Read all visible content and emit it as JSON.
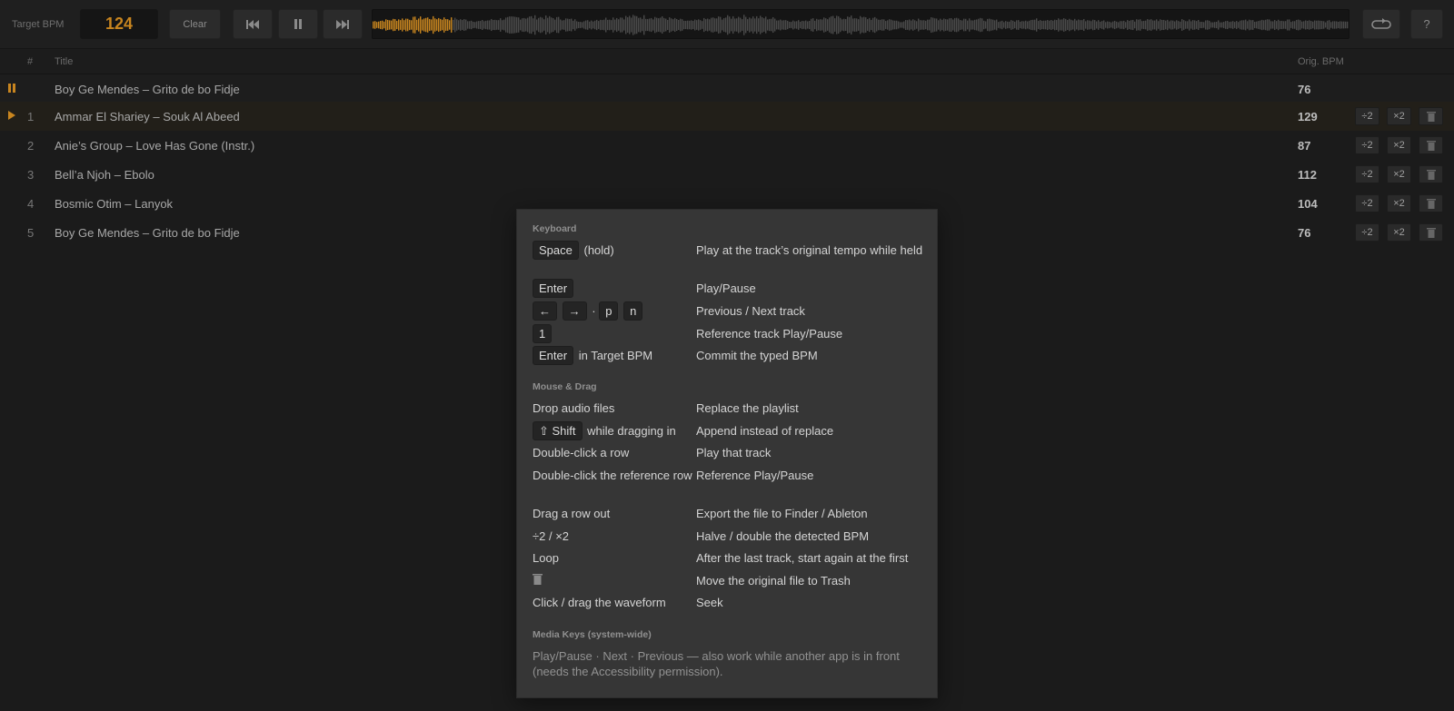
{
  "toolbar": {
    "target_bpm_label": "Target BPM",
    "target_bpm_value": "124",
    "clear_label": "Clear",
    "prev_icon": "skip-back-icon",
    "pause_icon": "pause-icon",
    "next_icon": "skip-forward-icon",
    "loop_icon": "loop-icon",
    "help_label": "?",
    "playback_progress": 0.08,
    "accent_color": "#c8851f"
  },
  "list": {
    "headers": {
      "num": "#",
      "title": "Title",
      "bpm": "Orig. BPM"
    },
    "reference": {
      "title": "Boy Ge Mendes – Grito de bo Fidje",
      "bpm": "76"
    },
    "tracks": [
      {
        "num": "1",
        "title": "Ammar El Shariey – Souk Al Abeed",
        "bpm": "129"
      },
      {
        "num": "2",
        "title": "Anie’s Group – Love Has Gone (Instr.)",
        "bpm": "87"
      },
      {
        "num": "3",
        "title": "Bell’a Njoh – Ebolo",
        "bpm": "112"
      },
      {
        "num": "4",
        "title": "Bosmic Otim – Lanyok",
        "bpm": "104"
      },
      {
        "num": "5",
        "title": "Boy Ge Mendes – Grito de bo Fidje",
        "bpm": "76"
      }
    ],
    "halve_label": "÷2",
    "double_label": "×2",
    "trash_icon": "trash-icon",
    "playing_icon": "play-triangle-icon",
    "reference_icon": "pause-bars-icon"
  },
  "help": {
    "keyboard_title": "Keyboard",
    "space_key": "Space",
    "space_suffix": "(hold)",
    "space_desc": "Play at the track’s original tempo while held",
    "enter_key": "Enter",
    "enter_desc": "Play/Pause",
    "left_key": "←",
    "right_key": "→",
    "sep_dot": "·",
    "p_key": "p",
    "n_key": "n",
    "nav_desc": "Previous / Next track",
    "one_key": "1",
    "one_desc": "Reference track Play/Pause",
    "enter2_key": "Enter",
    "enter2_suffix": "in Target BPM",
    "enter2_desc": "Commit the typed BPM",
    "mouse_title": "Mouse & Drag",
    "drop_key": "Drop audio files",
    "drop_desc": "Replace the playlist",
    "shift_key": "⇧ Shift",
    "shift_suffix": "while dragging in",
    "shift_desc": "Append instead of replace",
    "dbl_row_key": "Double-click a row",
    "dbl_row_desc": "Play that track",
    "dbl_ref_key": "Double-click the reference row",
    "dbl_ref_desc": "Reference Play/Pause",
    "drag_out_key": "Drag a row out",
    "drag_out_desc": "Export the file to Finder / Ableton",
    "halve_key": "÷2 / ×2",
    "halve_desc": "Halve / double the detected BPM",
    "loop_key": "Loop",
    "loop_desc": "After the last track, start again at the first",
    "trash_desc": "Move the original file to Trash",
    "waveform_key": "Click / drag the waveform",
    "waveform_desc": "Seek",
    "media_title": "Media Keys (system-wide)",
    "media_desc": "Play/Pause · Next · Previous — also work while another app is in front (needs the Accessibility permission)."
  }
}
